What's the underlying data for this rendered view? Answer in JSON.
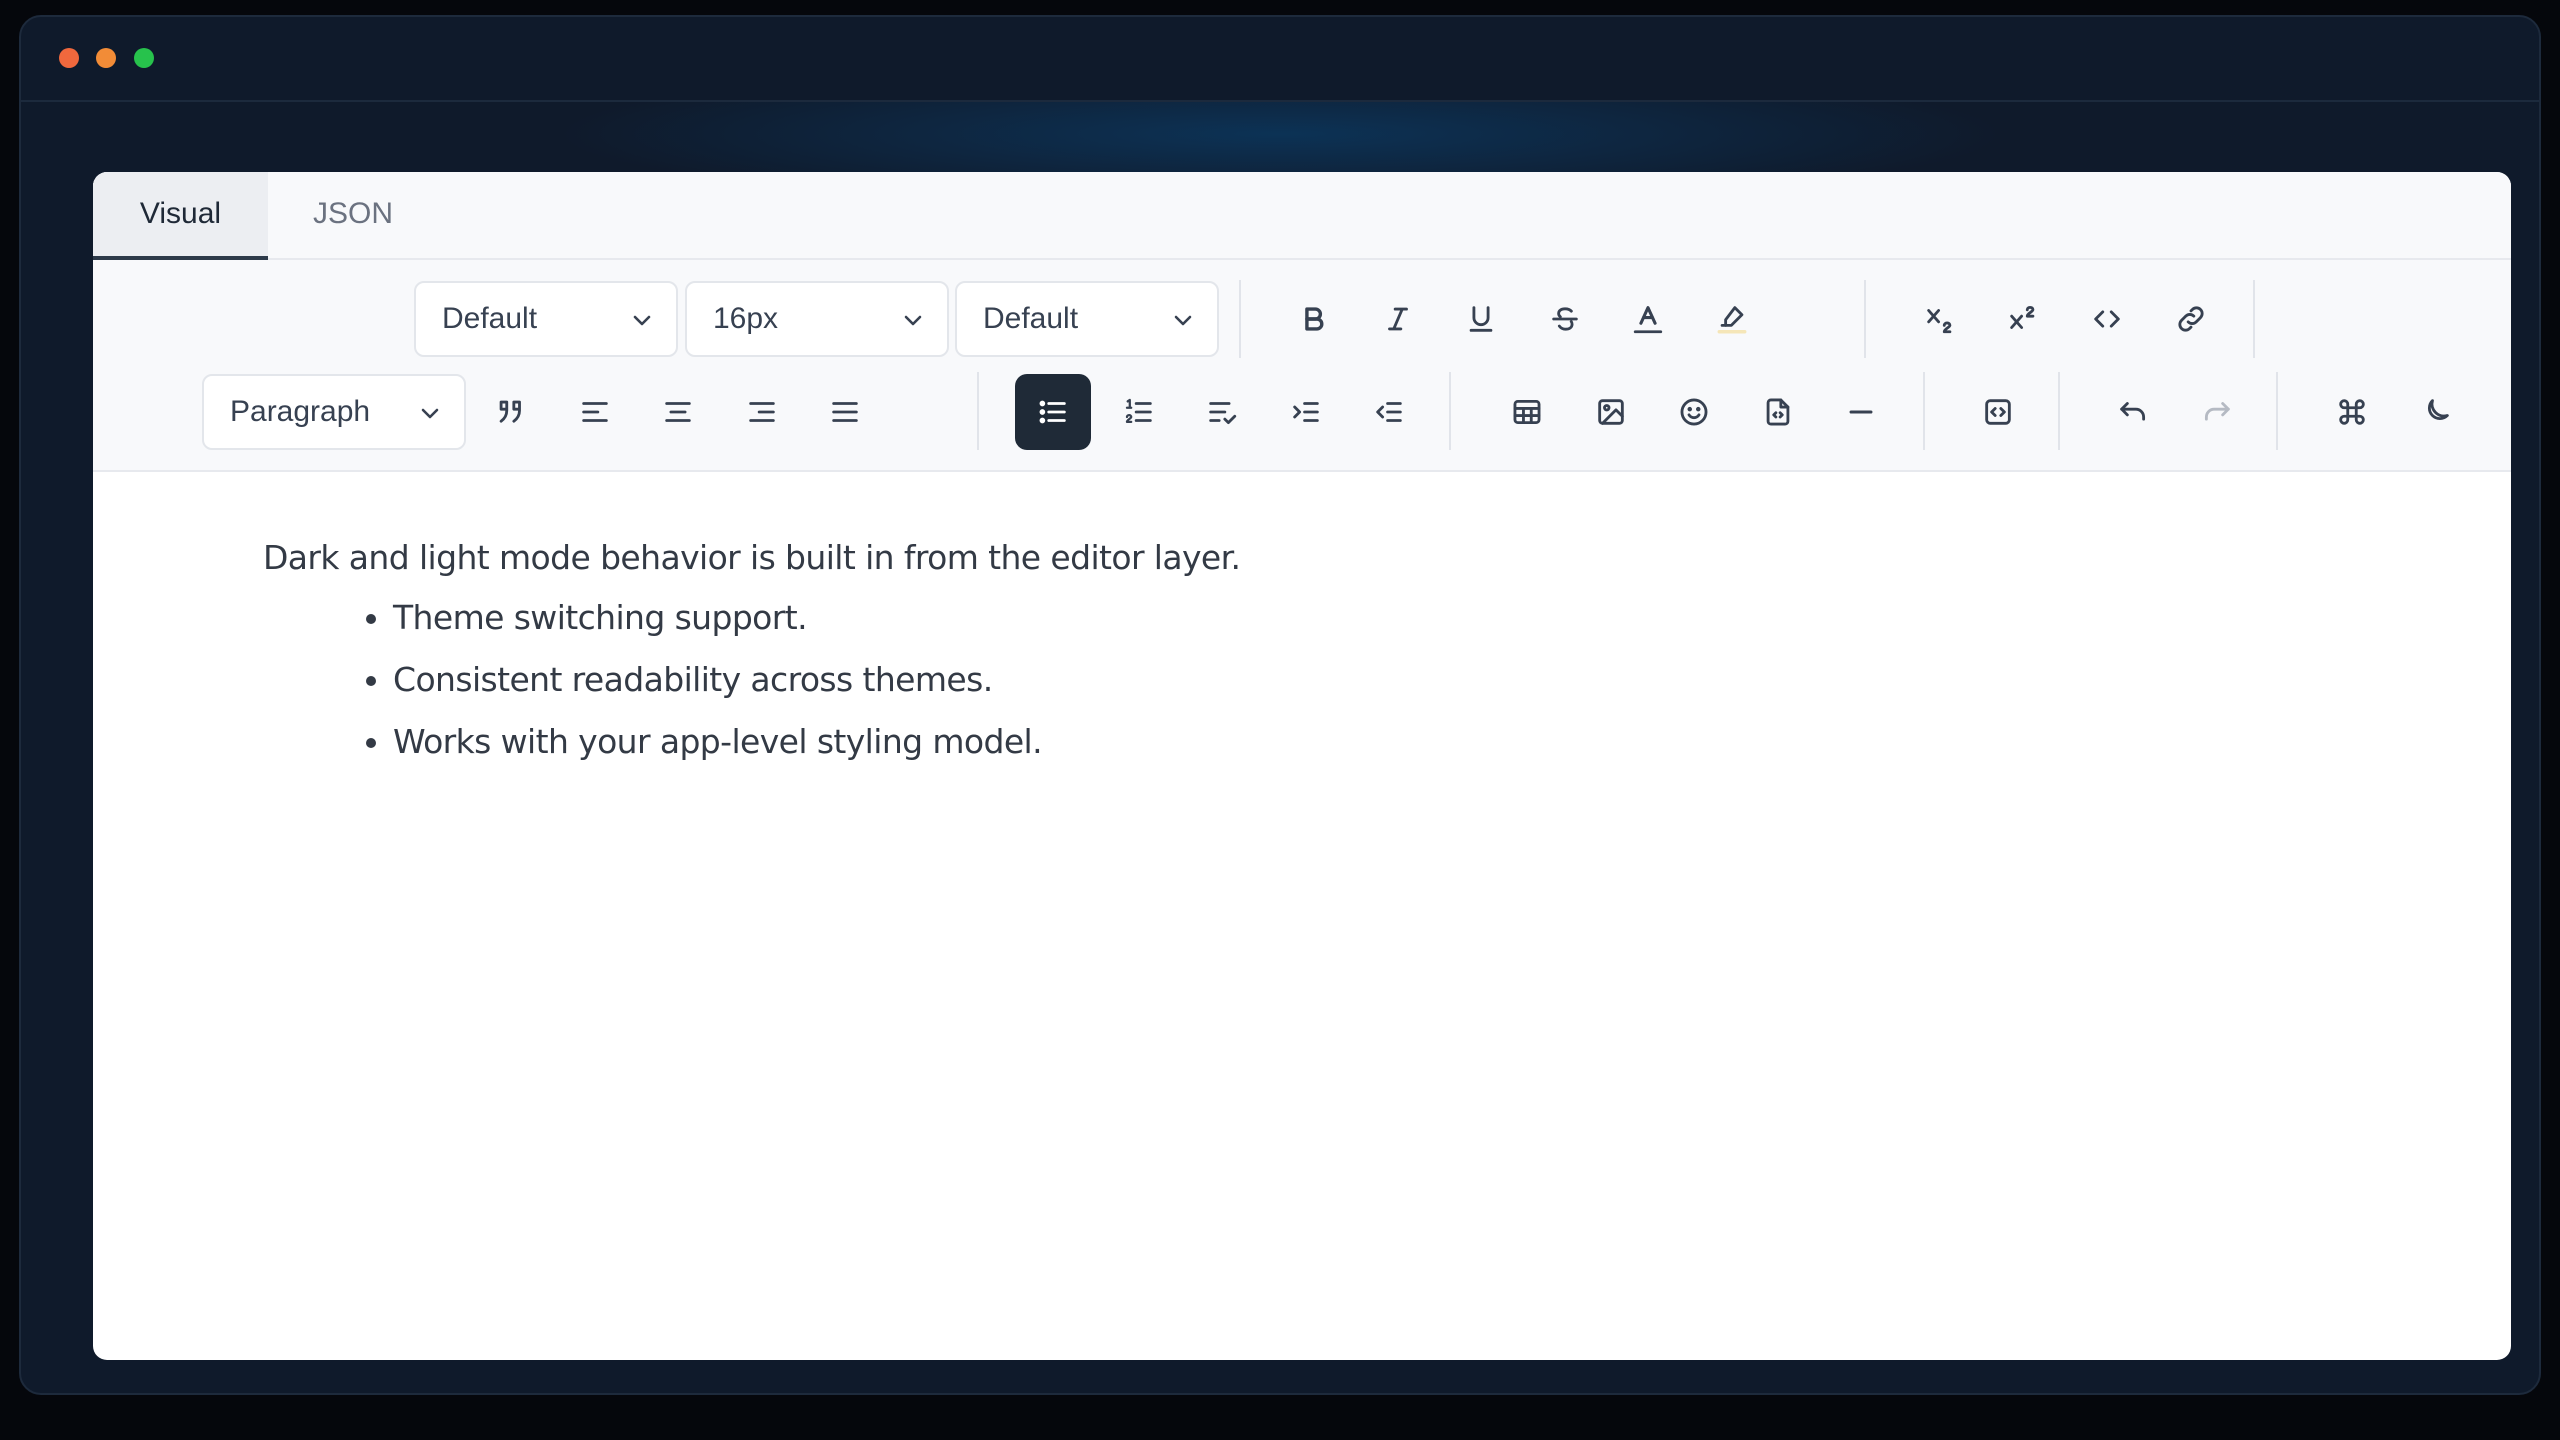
{
  "window": {
    "traffic_lights": [
      {
        "name": "close",
        "color": "#f0683d"
      },
      {
        "name": "minimize",
        "color": "#f28c37"
      },
      {
        "name": "zoom",
        "color": "#27c24c"
      }
    ]
  },
  "tabs": [
    {
      "label": "Visual",
      "active": true
    },
    {
      "label": "JSON",
      "active": false
    }
  ],
  "toolbar": {
    "font_family_select": {
      "value": "Default"
    },
    "font_size_select": {
      "value": "16px"
    },
    "line_height_select": {
      "value": "Default"
    },
    "block_type_select": {
      "value": "Paragraph"
    },
    "row1_buttons": [
      "bold-icon",
      "italic-icon",
      "underline-icon",
      "strikethrough-icon",
      "text-color-icon",
      "highlight-icon",
      "subscript-icon",
      "superscript-icon",
      "code-icon",
      "link-icon"
    ],
    "row2_buttons": [
      "blockquote-icon",
      "align-left-icon",
      "align-center-icon",
      "align-right-icon",
      "align-justify-icon",
      "bullet-list-icon",
      "ordered-list-icon",
      "task-list-icon",
      "indent-icon",
      "outdent-icon",
      "table-icon",
      "image-icon",
      "emoji-icon",
      "embed-file-icon",
      "horizontal-rule-icon",
      "code-block-icon",
      "undo-icon",
      "redo-icon",
      "command-icon",
      "theme-toggle-icon"
    ],
    "active_button": "bullet-list-icon",
    "colors": {
      "active_bg": "#1f2a37",
      "text_color_underline": "#374151",
      "highlight_underline": "#f5e6b8"
    }
  },
  "content": {
    "paragraph": "Dark and light mode behavior is built in from the editor layer.",
    "bullets": [
      "Theme switching support.",
      "Consistent readability across themes.",
      "Works with your app-level styling model."
    ]
  }
}
